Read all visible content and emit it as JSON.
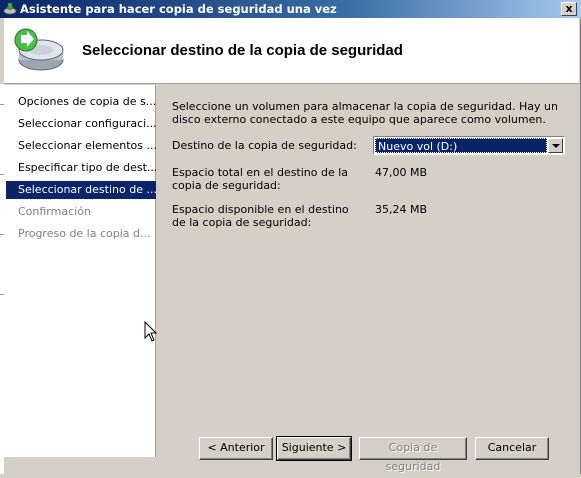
{
  "window": {
    "title": "Asistente para hacer copia de seguridad una vez",
    "close_label": "x"
  },
  "header": {
    "title": "Seleccionar destino de la copia de seguridad",
    "icon": "backup-drive-icon"
  },
  "sidebar": {
    "steps": [
      {
        "label": "Opciones de copia de s...",
        "state": "done"
      },
      {
        "label": "Seleccionar configuraci...",
        "state": "done"
      },
      {
        "label": "Seleccionar elementos ...",
        "state": "done"
      },
      {
        "label": "Especificar tipo de dest...",
        "state": "done"
      },
      {
        "label": "Seleccionar destino de ...",
        "state": "active"
      },
      {
        "label": "Confirmación",
        "state": "disabled"
      },
      {
        "label": "Progreso de la copia d...",
        "state": "disabled"
      }
    ]
  },
  "main": {
    "intro": "Seleccione un volumen para almacenar la copia de seguridad. Hay un disco externo conectado a este equipo que aparece como volumen.",
    "destination_label": "Destino de la copia de seguridad:",
    "destination_value": "Nuevo vol (D:)",
    "total_label": "Espacio total en el destino de la copia de seguridad:",
    "total_value": "47,00 MB",
    "free_label": "Espacio disponible en el destino de la copia de seguridad:",
    "free_value": "35,24 MB"
  },
  "footer": {
    "back": "< Anterior",
    "next": "Siguiente >",
    "backup": "Copia de seguridad",
    "cancel": "Cancelar"
  }
}
